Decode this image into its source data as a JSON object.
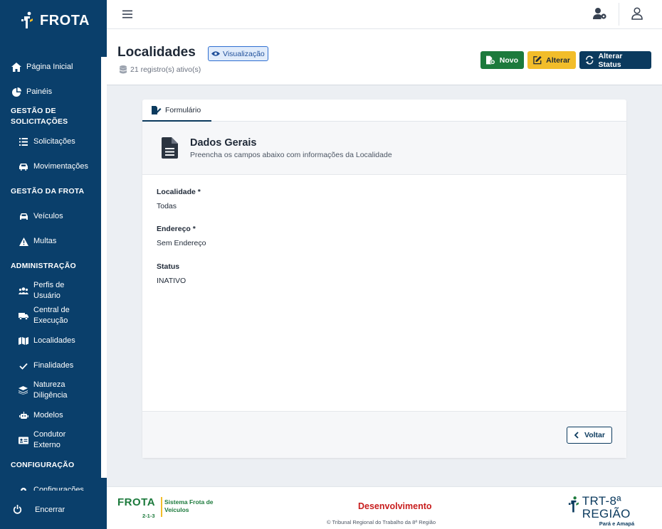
{
  "app": {
    "name": "FROTA"
  },
  "sidebar": {
    "items": [
      {
        "label": "Página Inicial"
      },
      {
        "label": "Painéis"
      },
      {
        "section": "GESTÃO DE SOLICITAÇÕES"
      },
      {
        "label": "Solicitações"
      },
      {
        "label": "Movimentações"
      },
      {
        "section": "GESTÃO DA FROTA"
      },
      {
        "label": "Veículos"
      },
      {
        "label": "Multas"
      },
      {
        "section": "ADMINISTRAÇÃO"
      },
      {
        "label": "Perfis de Usuário"
      },
      {
        "label": "Central de Execução"
      },
      {
        "label": "Localidades"
      },
      {
        "label": "Finalidades"
      },
      {
        "label": "Natureza Diligência"
      },
      {
        "label": "Modelos"
      },
      {
        "label": "Condutor Externo"
      },
      {
        "section": "CONFIGURAÇÃO"
      },
      {
        "label": "Configurações"
      }
    ],
    "logout": "Encerrar"
  },
  "header": {
    "title": "Localidades",
    "mode_badge": "Visualização",
    "records": "21 registro(s) ativo(s)",
    "buttons": {
      "novo": "Novo",
      "alterar": "Alterar",
      "status": "Alterar Status"
    }
  },
  "form": {
    "tab": "Formulário",
    "section_title": "Dados Gerais",
    "section_subtitle": "Preencha os campos abaixo com informações da Localidade",
    "fields": [
      {
        "label": "Localidade *",
        "value": "Todas"
      },
      {
        "label": "Endereço *",
        "value": "Sem Endereço"
      },
      {
        "label": "Status",
        "value": "INATIVO"
      }
    ],
    "back": "Voltar"
  },
  "footer": {
    "brand": "FROTA",
    "version": "2-1-3",
    "system_name": "Sistema Frota de Veículos",
    "environment": "Desenvolvimento",
    "copyright": "© Tribunal Regional do Trabalho da 8ª Região",
    "org": "TRT-8ª REGIÃO",
    "org_sub": "Pará e Amapá"
  },
  "colors": {
    "sidebar": "#0a3f6b",
    "primary": "#0b3a5e",
    "success": "#1c7a3c",
    "warning": "#f2bd2a",
    "danger": "#c81e1e"
  },
  "icons": [
    "home-icon",
    "pie-chart-icon",
    "list-icon",
    "car-icon",
    "warning-icon",
    "users-icon",
    "shipping-icon",
    "map-icon",
    "check-icon",
    "layers-icon",
    "robot-icon",
    "id-card-icon",
    "power-icon",
    "hamburger-icon",
    "user-gear-icon",
    "user-icon",
    "eye-icon",
    "database-icon",
    "file-plus-icon",
    "edit-icon",
    "sync-icon",
    "form-icon",
    "document-icon",
    "chevron-left-icon"
  ]
}
